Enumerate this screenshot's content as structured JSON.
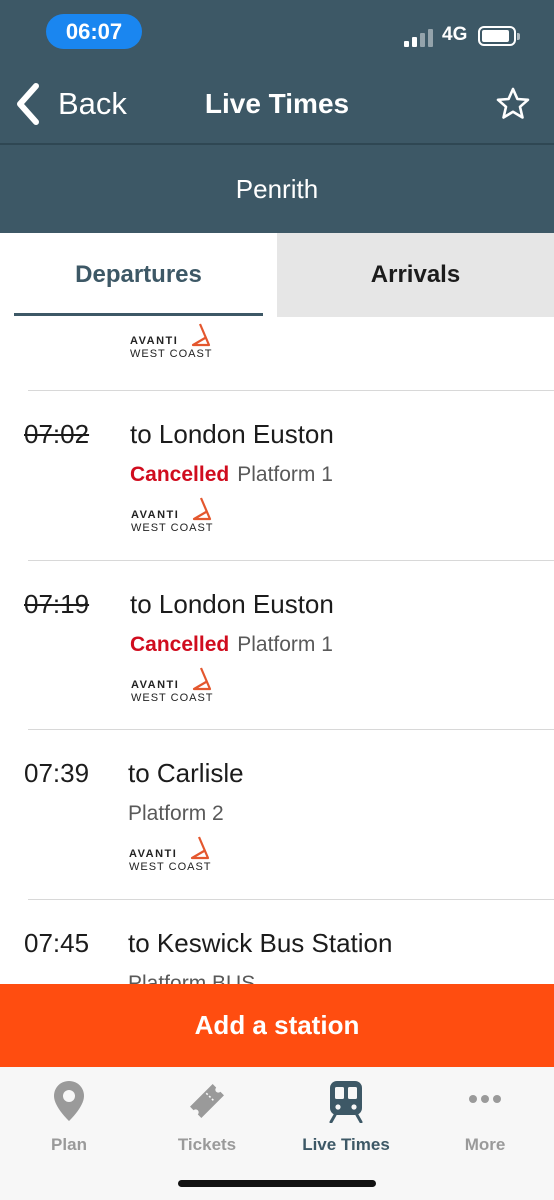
{
  "status_bar": {
    "time": "06:07",
    "network": "4G"
  },
  "nav": {
    "back_label": "Back",
    "title": "Live Times"
  },
  "station": {
    "name": "Penrith"
  },
  "tabs": {
    "departures": "Departures",
    "arrivals": "Arrivals"
  },
  "operator_logo": {
    "line1": "AVANTI",
    "line2": "WEST COAST",
    "accent_color": "#e4572e"
  },
  "services": [
    {
      "time": "07:02",
      "destination": "to London Euston",
      "status": "Cancelled",
      "platform": "Platform 1",
      "cancelled": true
    },
    {
      "time": "07:19",
      "destination": "to London Euston",
      "status": "Cancelled",
      "platform": "Platform 1",
      "cancelled": true
    },
    {
      "time": "07:39",
      "destination": "to Carlisle",
      "status": "",
      "platform": "Platform 2",
      "cancelled": false
    },
    {
      "time": "07:45",
      "destination": "to Keswick Bus Station",
      "status": "",
      "platform": "Platform BUS",
      "cancelled": false
    }
  ],
  "cta": {
    "label": "Add a station",
    "color": "#ff4d10"
  },
  "tab_bar": {
    "items": [
      {
        "label": "Plan",
        "icon": "location-pin-icon"
      },
      {
        "label": "Tickets",
        "icon": "ticket-icon"
      },
      {
        "label": "Live Times",
        "icon": "train-icon",
        "active": true
      },
      {
        "label": "More",
        "icon": "more-dots-icon"
      }
    ]
  },
  "colors": {
    "header": "#3d5866",
    "cancelled": "#d00c1e",
    "ios_time_pill": "#1a86f0"
  }
}
